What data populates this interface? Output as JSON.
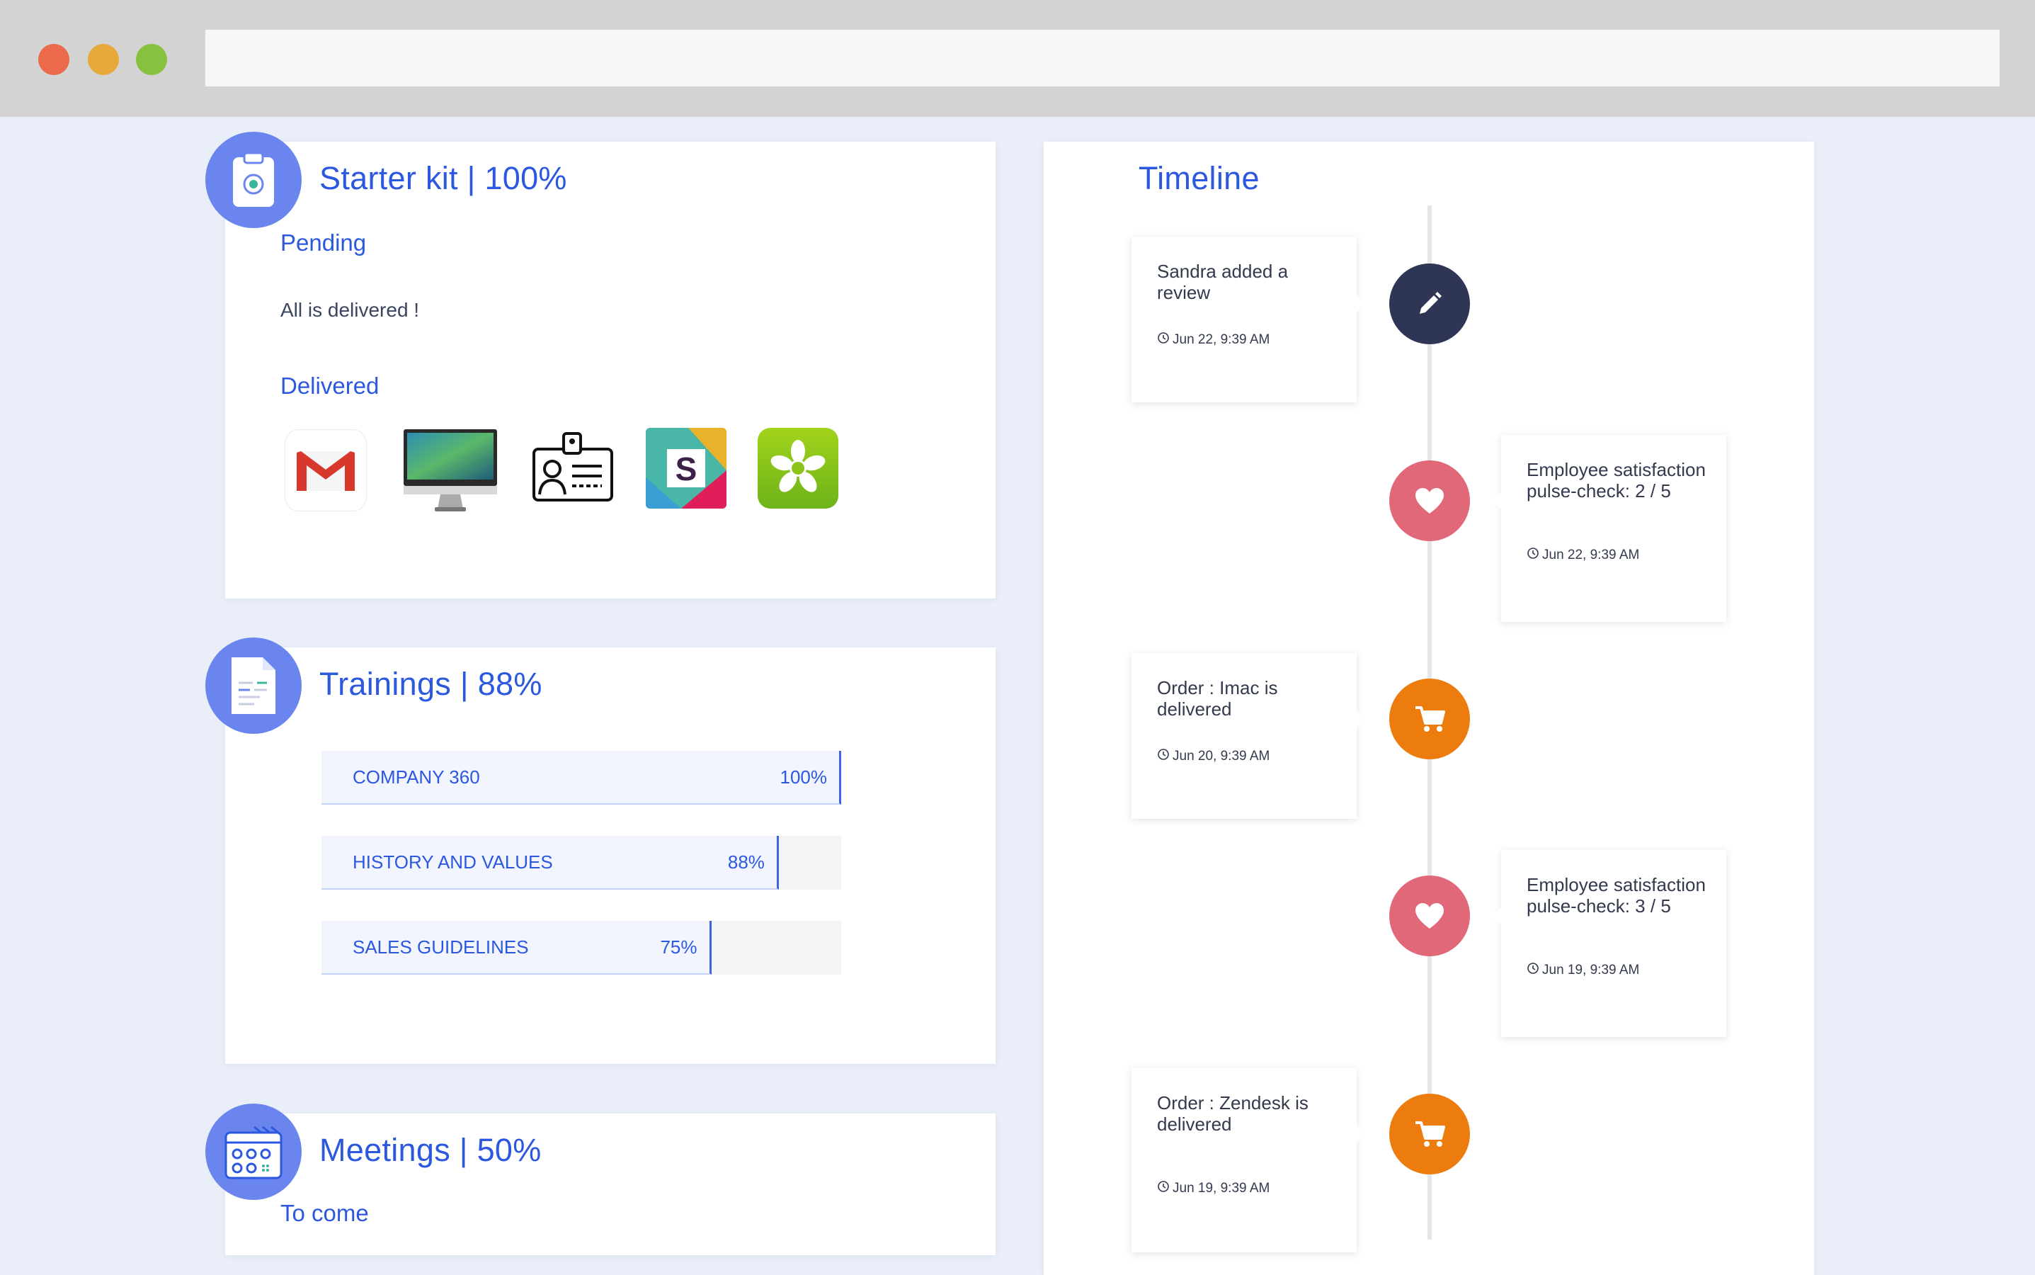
{
  "browser": {
    "url": ""
  },
  "starter": {
    "title": "Starter kit | 100%",
    "pending_label": "Pending",
    "pending_text": "All is delivered !",
    "delivered_label": "Delivered",
    "items": [
      "gmail-icon",
      "imac-icon",
      "badge-card-icon",
      "slack-icon",
      "zenefits-icon"
    ]
  },
  "trainings": {
    "title": "Trainings | 88%",
    "courses": [
      {
        "name": "COMPANY 360",
        "percent_label": "100%",
        "progress": 1.0
      },
      {
        "name": "HISTORY AND VALUES",
        "percent_label": "88%",
        "progress": 0.88
      },
      {
        "name": "SALES GUIDELINES",
        "percent_label": "75%",
        "progress": 0.75
      }
    ]
  },
  "meetings": {
    "title": "Meetings | 50%",
    "subtitle": "To come"
  },
  "timeline": {
    "title": "Timeline",
    "events": [
      {
        "text": "Sandra added a review",
        "time": "Jun 22, 9:39 AM",
        "icon": "pencil-icon",
        "color": "#2f3555"
      },
      {
        "text": "Employee satisfaction pulse-check: 2 / 5",
        "time": "Jun 22, 9:39 AM",
        "icon": "heart-icon",
        "color": "#e06878"
      },
      {
        "text": "Order : Imac is delivered",
        "time": "Jun 20, 9:39 AM",
        "icon": "cart-icon",
        "color": "#ec7c0e"
      },
      {
        "text": "Employee satisfaction pulse-check: 3 / 5",
        "time": "Jun 19, 9:39 AM",
        "icon": "heart-icon",
        "color": "#e06878"
      },
      {
        "text": "Order : Zendesk is delivered",
        "time": "Jun 19, 9:39 AM",
        "icon": "cart-icon",
        "color": "#ec7c0e"
      }
    ]
  },
  "colors": {
    "accent": "#2c58e0",
    "badge": "#6a85ee",
    "background": "#e9eef8"
  }
}
